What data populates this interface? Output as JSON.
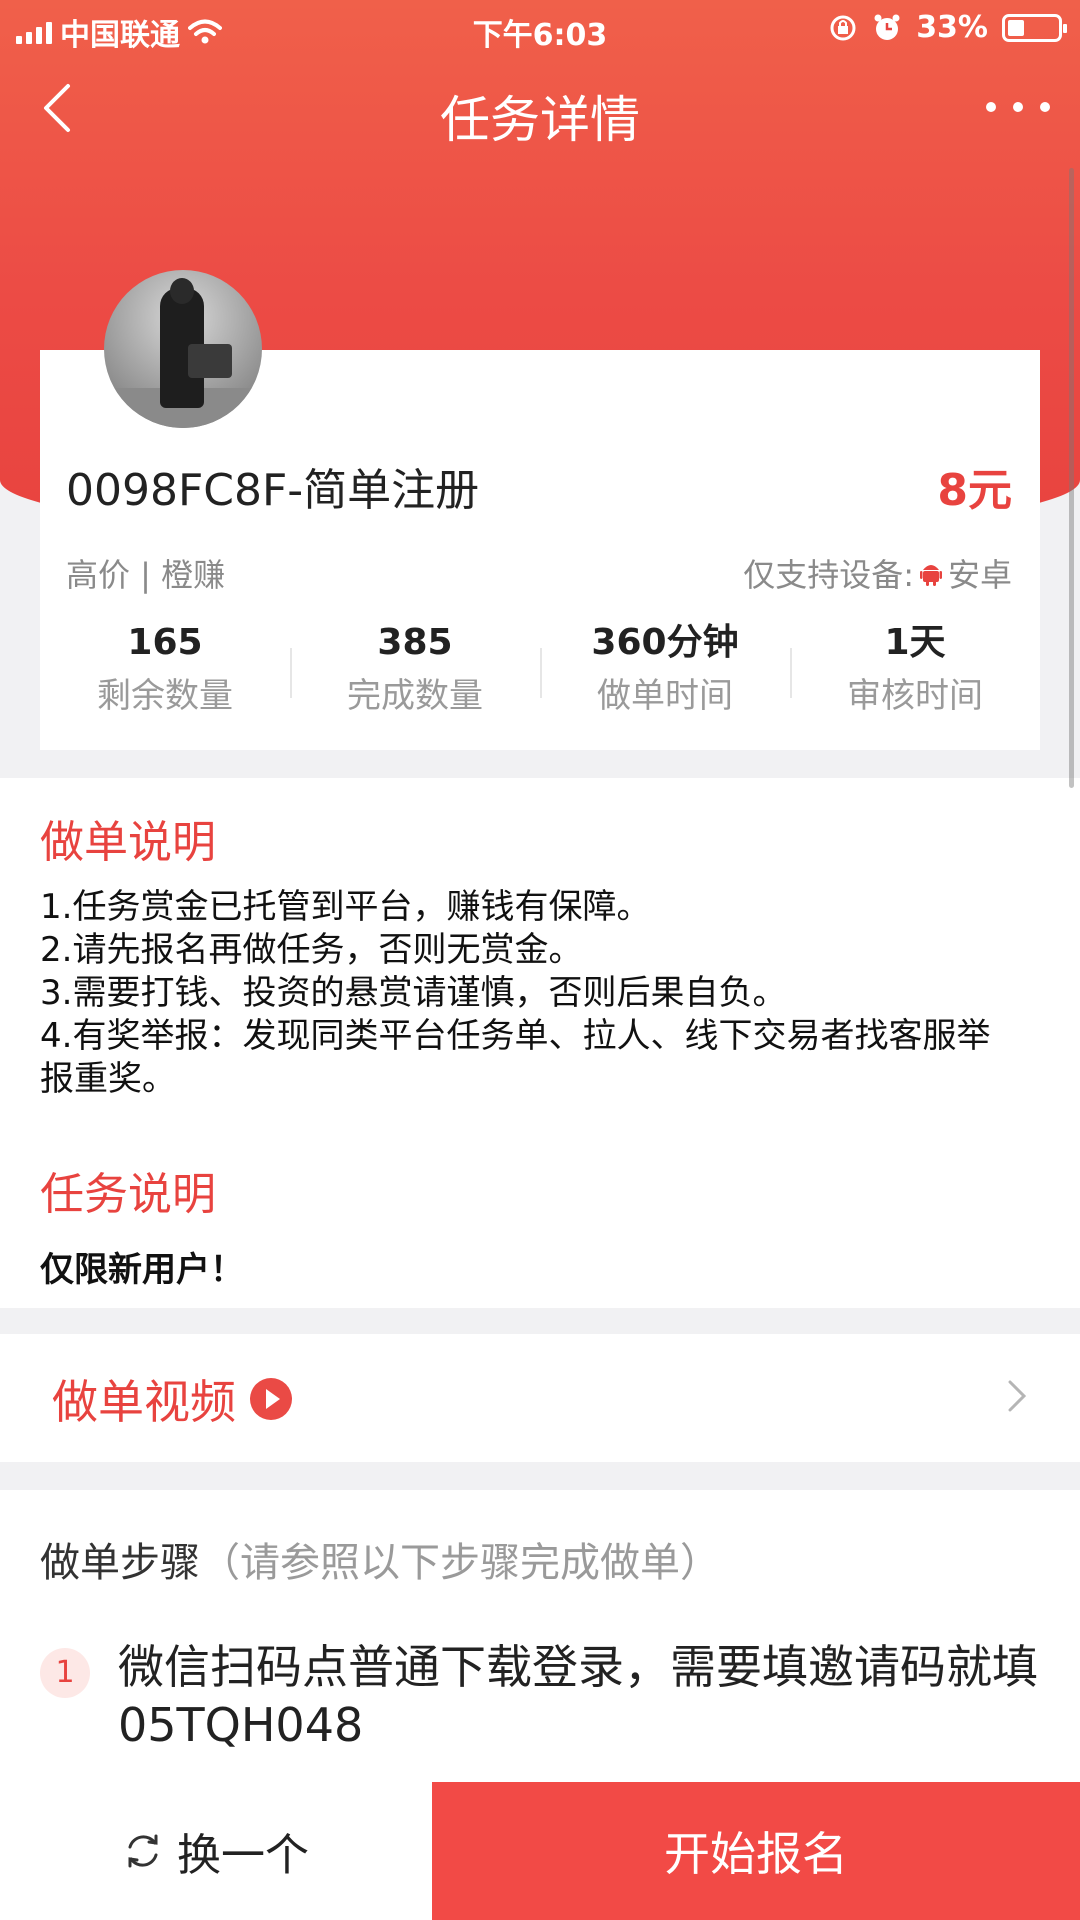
{
  "status_bar": {
    "carrier": "中国联通",
    "time": "下午6:03",
    "battery": "33%",
    "battery_level": 0.33
  },
  "nav": {
    "title": "任务详情"
  },
  "task": {
    "title": "0098FC8F-简单注册",
    "price": "8元",
    "tags": "高价 | 橙赚",
    "device_label": "仅支持设备:",
    "device": "安卓",
    "stats": [
      {
        "value": "165",
        "label": "剩余数量"
      },
      {
        "value": "385",
        "label": "完成数量"
      },
      {
        "value": "360分钟",
        "label": "做单时间"
      },
      {
        "value": "1天",
        "label": "审核时间"
      }
    ]
  },
  "instructions": {
    "heading": "做单说明",
    "rules": [
      "1.任务赏金已托管到平台，赚钱有保障。",
      "2.请先报名再做任务，否则无赏金。",
      "3.需要打钱、投资的悬赏请谨慎，否则后果自负。",
      "4.有奖举报：发现同类平台任务单、拉人、线下交易者找客服举报重奖。"
    ],
    "task_heading": "任务说明",
    "task_note": "仅限新用户！"
  },
  "video": {
    "label": "做单视频"
  },
  "steps": {
    "title": "做单步骤",
    "hint": "（请参照以下步骤完成做单）",
    "items": [
      {
        "num": "1",
        "text": "微信扫码点普通下载登录，需要填邀请码就填05TQH048"
      }
    ]
  },
  "bottom": {
    "swap_label": "换一个",
    "start_label": "开始报名"
  },
  "colors": {
    "accent": "#e8433f",
    "start_button": "#f24a46"
  }
}
